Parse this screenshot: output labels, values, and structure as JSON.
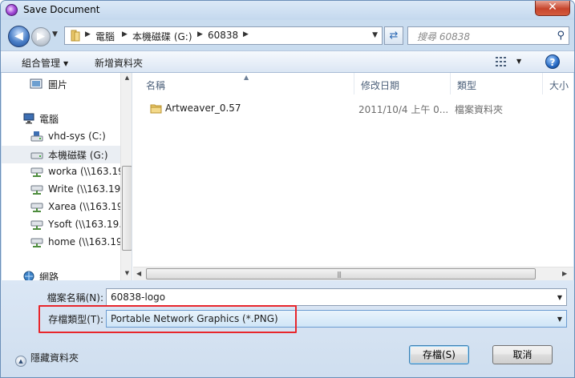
{
  "window": {
    "title": "Save Document",
    "close_glyph": "✕"
  },
  "nav": {
    "back_glyph": "◀",
    "forward_glyph": "▶",
    "breadcrumb": [
      "電腦",
      "本機磁碟 (G:)",
      "60838"
    ],
    "search_placeholder": "搜尋 60838"
  },
  "toolbar": {
    "organize": "組合管理",
    "new_folder": "新增資料夾",
    "help_glyph": "?"
  },
  "sidebar": {
    "items": [
      {
        "label": "圖片",
        "icon": "pictures-icon"
      },
      {
        "label": "電腦",
        "icon": "computer-icon"
      },
      {
        "label": "vhd-sys (C:)",
        "icon": "drive-icon"
      },
      {
        "label": "本機磁碟 (G:)",
        "icon": "drive-icon",
        "selected": true
      },
      {
        "label": "worka (\\\\163.19",
        "icon": "network-drive-icon"
      },
      {
        "label": "Write (\\\\163.19.",
        "icon": "network-drive-icon"
      },
      {
        "label": "Xarea (\\\\163.19",
        "icon": "network-drive-icon"
      },
      {
        "label": "Ysoft (\\\\163.19.3",
        "icon": "network-drive-icon"
      },
      {
        "label": "home (\\\\163.19",
        "icon": "network-drive-icon"
      },
      {
        "label": "網路",
        "icon": "network-icon"
      }
    ]
  },
  "filelist": {
    "columns": [
      "名稱",
      "修改日期",
      "類型",
      "大小"
    ],
    "rows": [
      {
        "name": "Artweaver_0.57",
        "modified": "2011/10/4 上午 0...",
        "type": "檔案資料夾",
        "size": ""
      }
    ]
  },
  "form": {
    "filename_label": "檔案名稱(N):",
    "filename_value": "60838-logo",
    "filetype_label": "存檔類型(T):",
    "filetype_value": "Portable Network Graphics (*.PNG)",
    "hide_folders": "隱藏資料夾",
    "save_button": "存檔(S)",
    "cancel_button": "取消"
  },
  "colors": {
    "highlight_box": "#e8262c",
    "window_frame": "#c9dcef",
    "accent": "#2669c4"
  }
}
